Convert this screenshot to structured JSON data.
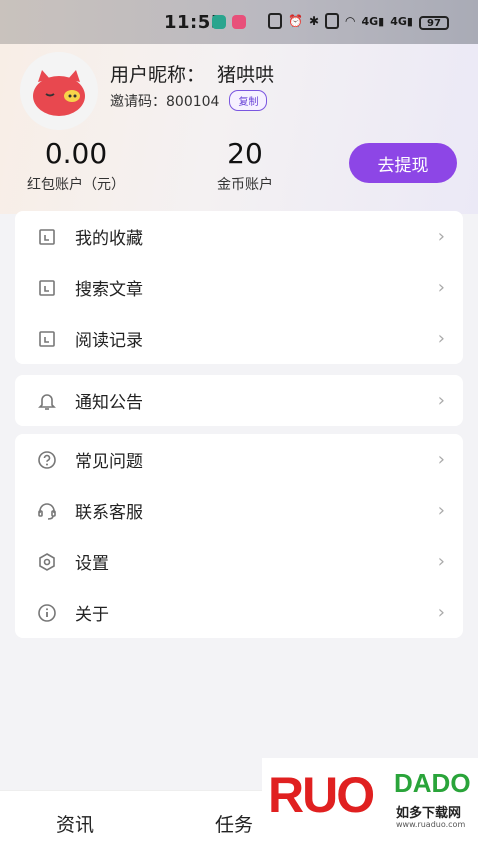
{
  "status_bar": {
    "time": "11:55",
    "battery": "97"
  },
  "profile": {
    "nickname_label": "用户昵称：",
    "nickname": "猪哄哄",
    "invite_label": "邀请码：",
    "invite_code": "800104",
    "copy_label": "复制"
  },
  "accounts": {
    "red_packet_value": "0.00",
    "red_packet_label": "红包账户（元）",
    "coin_value": "20",
    "coin_label": "金币账户",
    "withdraw_label": "去提现"
  },
  "menu_group1": [
    {
      "label": "我的收藏",
      "icon": "document-icon"
    },
    {
      "label": "搜索文章",
      "icon": "document-icon"
    },
    {
      "label": "阅读记录",
      "icon": "document-icon"
    }
  ],
  "menu_group2": [
    {
      "label": "通知公告",
      "icon": "bell-icon"
    }
  ],
  "menu_group3": [
    {
      "label": "常见问题",
      "icon": "question-icon"
    },
    {
      "label": "联系客服",
      "icon": "headset-icon"
    },
    {
      "label": "设置",
      "icon": "settings-icon"
    },
    {
      "label": "关于",
      "icon": "info-icon"
    }
  ],
  "tabbar": {
    "tab1": "资讯",
    "tab2": "任务"
  },
  "watermark": {
    "big": "RUO",
    "small": "DADO",
    "cn": "如多下载网",
    "url": "www.ruaduo.com"
  },
  "colors": {
    "accent": "#8d46e6",
    "avatar_pig": "#e8484f"
  }
}
